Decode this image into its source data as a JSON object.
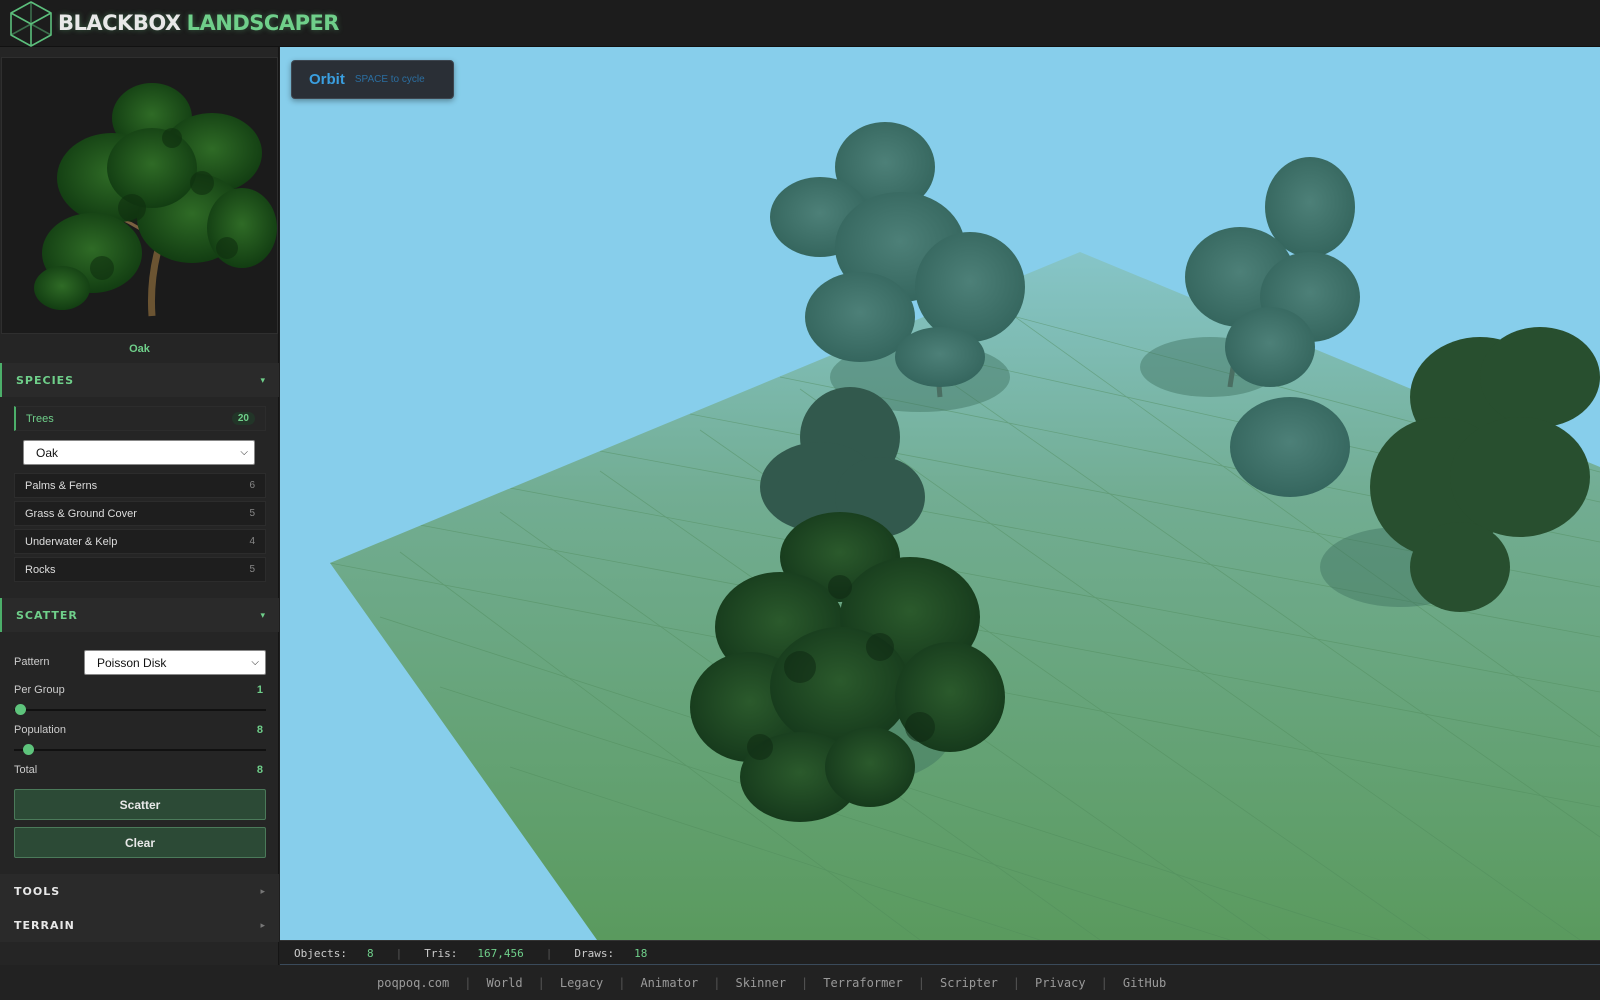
{
  "brand": {
    "part1": "BLACKBOX",
    "part2": "LANDSCAPER",
    "accent": "#6fcf8a"
  },
  "preview": {
    "name": "Oak"
  },
  "species": {
    "title": "SPECIES",
    "chevron": "▾",
    "categories": [
      {
        "label": "Trees",
        "count": "20",
        "active": true
      },
      {
        "label": "Palms & Ferns",
        "count": "6"
      },
      {
        "label": "Grass & Ground Cover",
        "count": "5"
      },
      {
        "label": "Underwater & Kelp",
        "count": "4"
      },
      {
        "label": "Rocks",
        "count": "5"
      }
    ],
    "selected_species": "Oak"
  },
  "scatter": {
    "title": "SCATTER",
    "chevron": "▾",
    "pattern_label": "Pattern",
    "pattern_value": "Poisson Disk",
    "per_group_label": "Per Group",
    "per_group_value": "1",
    "population_label": "Population",
    "population_value": "8",
    "total_label": "Total",
    "total_value": "8",
    "scatter_button": "Scatter",
    "clear_button": "Clear"
  },
  "tools": {
    "title": "TOOLS",
    "chevron": "▸"
  },
  "terrain": {
    "title": "TERRAIN",
    "chevron": "▸"
  },
  "viewport": {
    "mode": "Orbit",
    "mode_hint": "SPACE to cycle"
  },
  "status": {
    "objects_label": "Objects:",
    "objects_value": "8",
    "tris_label": "Tris:",
    "tris_value": "167,456",
    "draws_label": "Draws:",
    "draws_value": "18"
  },
  "footer": {
    "links": [
      "poqpoq.com",
      "World",
      "Legacy",
      "Animator",
      "Skinner",
      "Terraformer",
      "Scripter",
      "Privacy",
      "GitHub"
    ],
    "separator": "|"
  },
  "colors": {
    "sky": "#87ceeb",
    "ground": "#6aa77c",
    "panel": "#252525"
  }
}
